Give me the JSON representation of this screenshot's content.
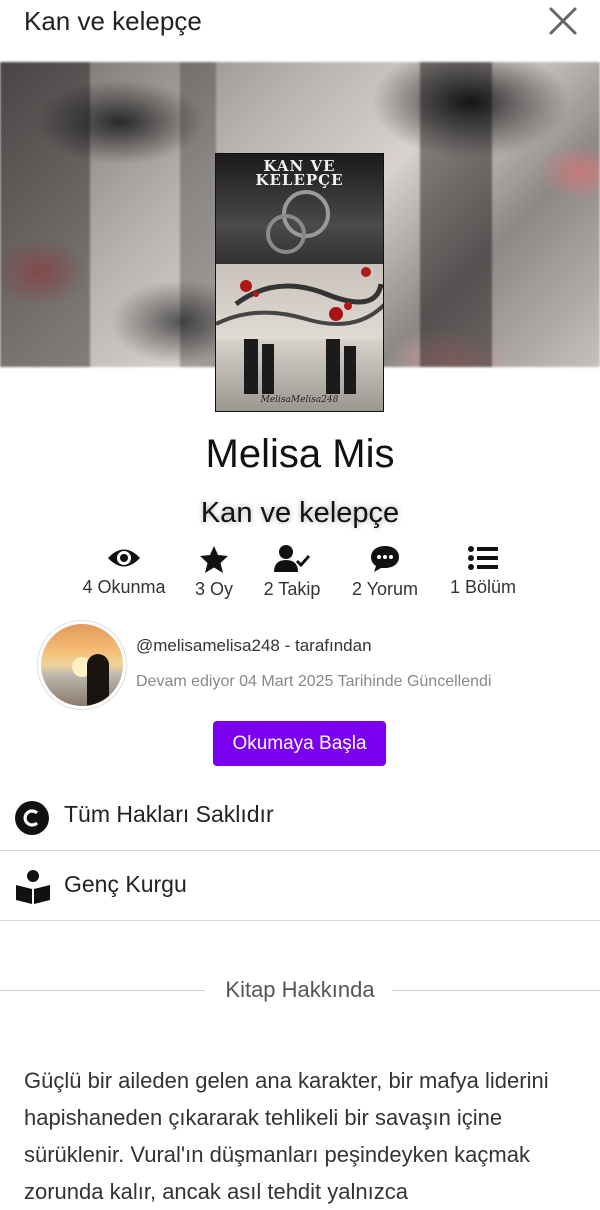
{
  "header": {
    "title": "Kan ve kelepçe"
  },
  "cover": {
    "title_line1": "KAN VE",
    "title_line2": "KELEPÇE",
    "signature": "MelisaMelisa248"
  },
  "author_name": "Melisa Mis",
  "book_title": "Kan ve kelepçe",
  "stats": [
    {
      "icon": "eye-icon",
      "label": "4 Okunma"
    },
    {
      "icon": "star-icon",
      "label": "3 Oy"
    },
    {
      "icon": "user-check-icon",
      "label": "2 Takip"
    },
    {
      "icon": "comment-icon",
      "label": "2 Yorum"
    },
    {
      "icon": "list-icon",
      "label": "1 Bölüm"
    }
  ],
  "byline": "@melisamelisa248 - tarafından",
  "updated": "Devam ediyor 04 Mart 2025 Tarihinde Güncellendi",
  "read_button": "Okumaya Başla",
  "info_rows": [
    {
      "icon": "copyright-icon",
      "label": "Tüm Hakları Saklıdır"
    },
    {
      "icon": "reader-book-icon",
      "label": "Genç Kurgu"
    }
  ],
  "about_heading": "Kitap Hakkında",
  "description": "Güçlü bir aileden gelen ana karakter, bir mafya liderini hapishaneden çıkararak tehlikeli bir savaşın içine sürüklenir. Vural'ın düşmanları peşindeyken kaçmak zorunda kalır, ancak asıl tehdit yalnızca"
}
